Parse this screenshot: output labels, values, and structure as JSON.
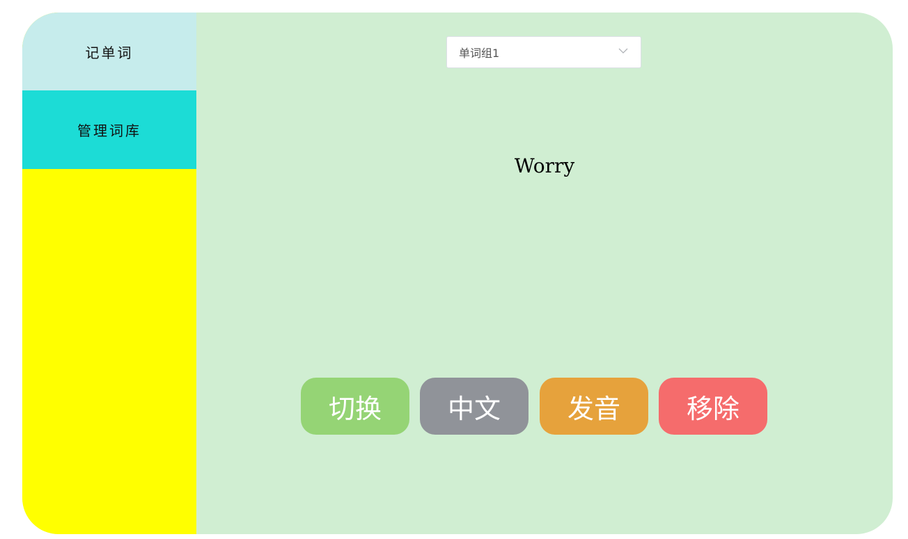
{
  "sidebar": {
    "items": [
      {
        "label": "记单词"
      },
      {
        "label": "管理词库"
      }
    ]
  },
  "wordgroup_select": {
    "value": "单词组1",
    "icon": "chevron-down-icon"
  },
  "current_word": "Worry",
  "actions": {
    "switch_label": "切换",
    "chinese_label": "中文",
    "pronounce_label": "发音",
    "remove_label": "移除"
  },
  "colors": {
    "main_bg": "#d0eed2",
    "sidebar_bg": "#ffff00",
    "nav_item_1_bg": "#c6ecec",
    "nav_item_2_bg": "#1cdcd6",
    "switch_btn": "#95d475",
    "chinese_btn": "#909399",
    "pronounce_btn": "#e6a23c",
    "remove_btn": "#f56c6c"
  }
}
